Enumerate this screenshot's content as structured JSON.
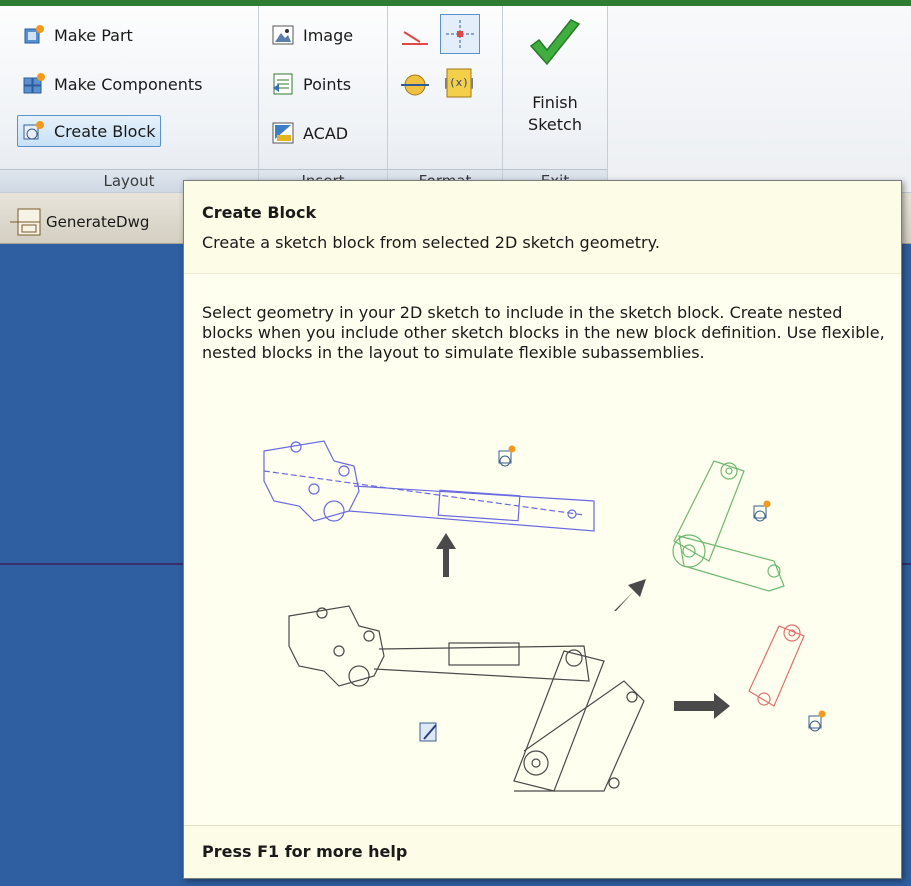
{
  "ribbon": {
    "layout_panel": {
      "title": "Layout",
      "buttons": [
        {
          "label": "Make Part",
          "icon": "make-part-icon"
        },
        {
          "label": "Make Components",
          "icon": "make-components-icon"
        },
        {
          "label": "Create Block",
          "icon": "create-block-icon",
          "selected": true
        }
      ]
    },
    "insert_panel": {
      "title": "Insert",
      "buttons": [
        {
          "label": "Image",
          "icon": "image-icon"
        },
        {
          "label": "Points",
          "icon": "points-icon"
        },
        {
          "label": "ACAD",
          "icon": "acad-icon"
        }
      ]
    },
    "format_panel": {
      "title": "Format",
      "icons": [
        "construction-icon",
        "centerpoint-icon",
        "center-line-icon",
        "driven-dimension-icon"
      ]
    },
    "exit_panel": {
      "title": "Exit",
      "finish_line1": "Finish",
      "finish_line2": "Sketch",
      "icon": "checkmark-icon"
    }
  },
  "document_tab": {
    "label": "GenerateDwg",
    "icon": "layout-document-icon"
  },
  "tooltip": {
    "title": "Create Block",
    "subtitle": "Create a sketch block from selected 2D sketch geometry.",
    "body": "Select geometry in your 2D sketch to include in the sketch block. Create nested blocks when you include other sketch blocks in the new block definition. Use flexible, nested blocks in the layout to simulate flexible subassemblies.",
    "footer": "Press F1 for more help"
  },
  "colors": {
    "canvas": "#2f5fa0",
    "tooltip_bg": "#fffff0",
    "blue_geometry": "#6a6ae0",
    "green_geometry": "#6fb76f",
    "red_geometry": "#e07070",
    "checkmark": "#3fae3f"
  }
}
